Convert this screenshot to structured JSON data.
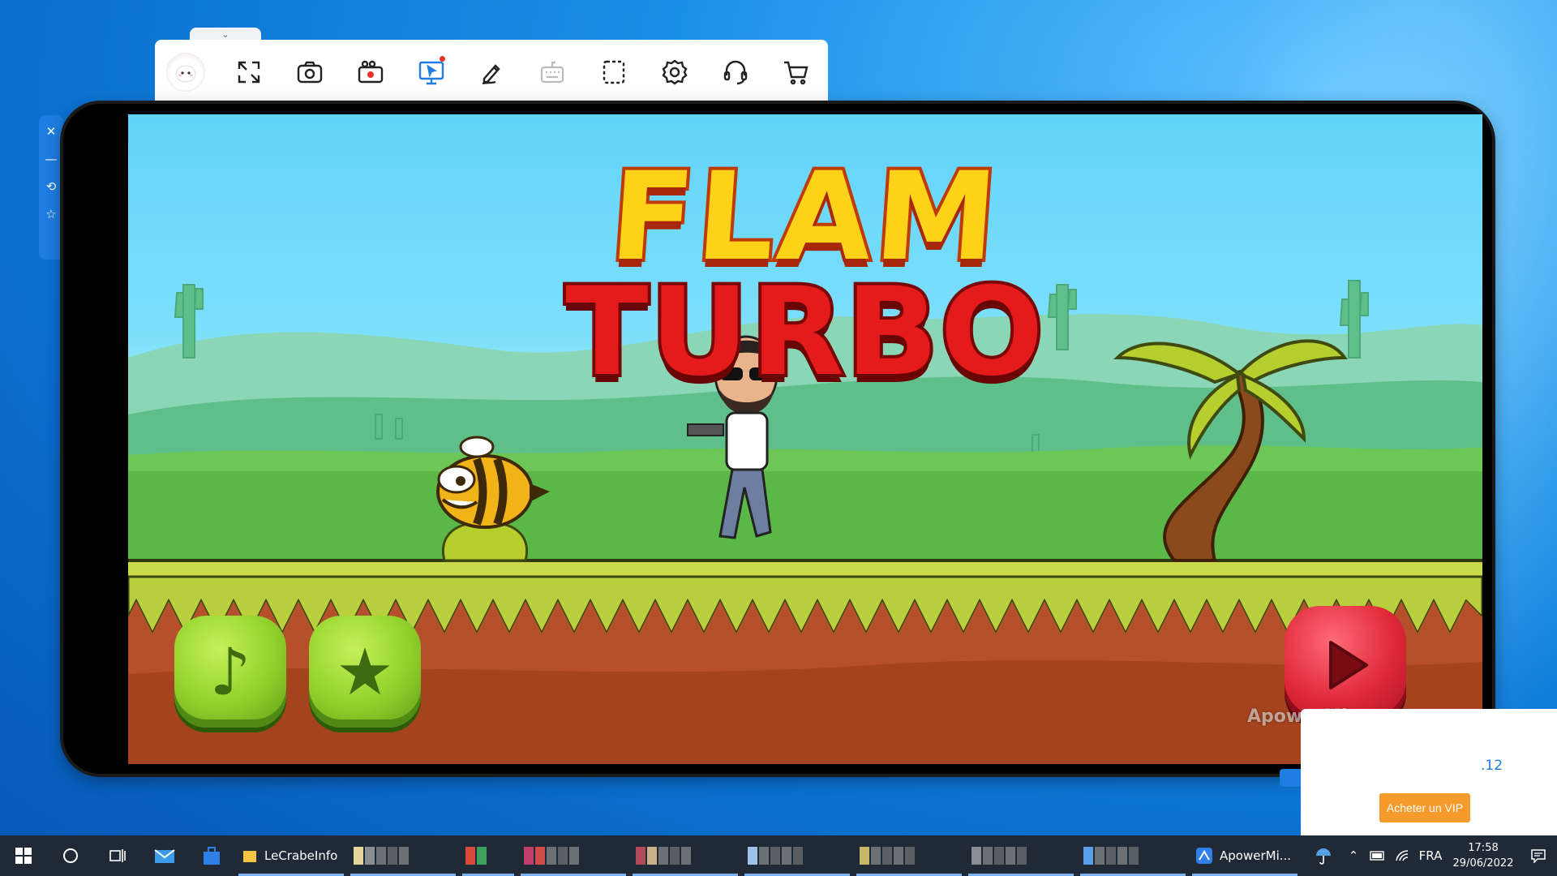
{
  "toolbar": {
    "items": [
      {
        "name": "fullscreen-icon"
      },
      {
        "name": "camera-icon"
      },
      {
        "name": "record-icon"
      },
      {
        "name": "screen-control-icon"
      },
      {
        "name": "whiteboard-icon"
      },
      {
        "name": "keyboard-icon"
      },
      {
        "name": "screenshot-region-icon"
      },
      {
        "name": "settings-icon"
      },
      {
        "name": "support-icon"
      },
      {
        "name": "cart-icon"
      }
    ]
  },
  "sidepanel": {
    "close": "✕",
    "minimize": "—",
    "rotate": "⟲",
    "pin": "☆"
  },
  "game": {
    "title_line1": "FLAM",
    "title_line2": "TURBO",
    "music_button": "♪",
    "star_button": "★",
    "watermark": "ApowerMirror"
  },
  "popup": {
    "partial_text": ".12",
    "vip_button": "Acheter un VIP"
  },
  "taskbar": {
    "apps": [
      {
        "label": "LeCrabeInfo",
        "icon_color": "#f4c542"
      },
      {
        "label": "ApowerMi...",
        "icon_color": "#2f7fe6"
      }
    ],
    "tray": {
      "language": "FRA",
      "time": "17:58",
      "date": "29/06/2022"
    }
  },
  "colors": {
    "desktop": "#0a6fcf",
    "toolbar_accent": "#1d7de0",
    "vip": "#f79a2c",
    "taskbar": "#1f2a36"
  }
}
